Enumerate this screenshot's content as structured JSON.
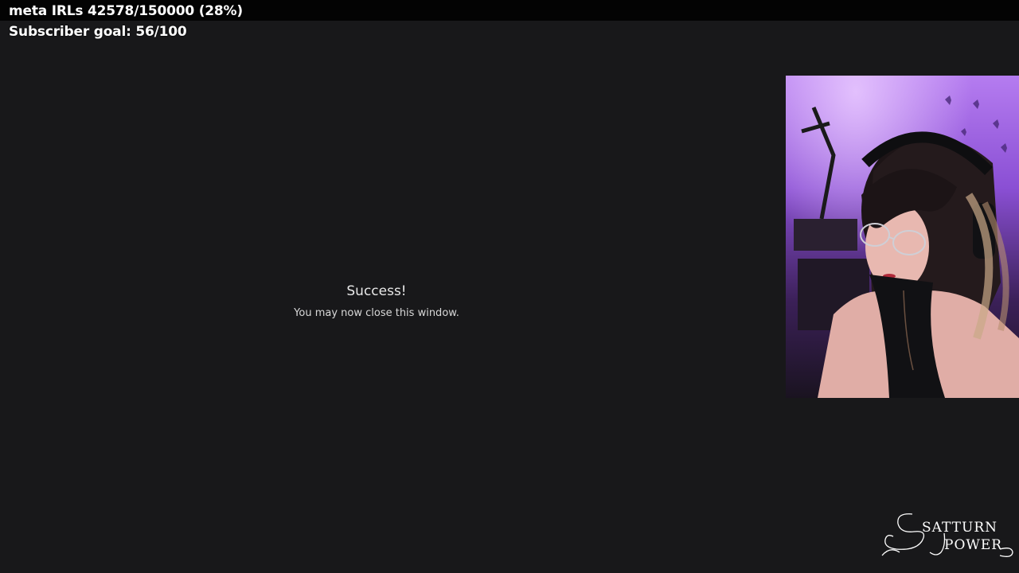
{
  "overlay": {
    "goal_line": "meta IRLs 42578/150000 (28%)",
    "subscriber_line": "Subscriber goal: 56/100"
  },
  "browser_message": {
    "title": "Success!",
    "body": "You may now close this window."
  },
  "webcam": {
    "background_color": "#7a45c8"
  },
  "logo": {
    "text_line1": "SATTURN",
    "text_line2": "POWER"
  },
  "colors": {
    "page_background": "#18181a",
    "top_strip": "#030303",
    "overlay_text": "#ffffff"
  }
}
